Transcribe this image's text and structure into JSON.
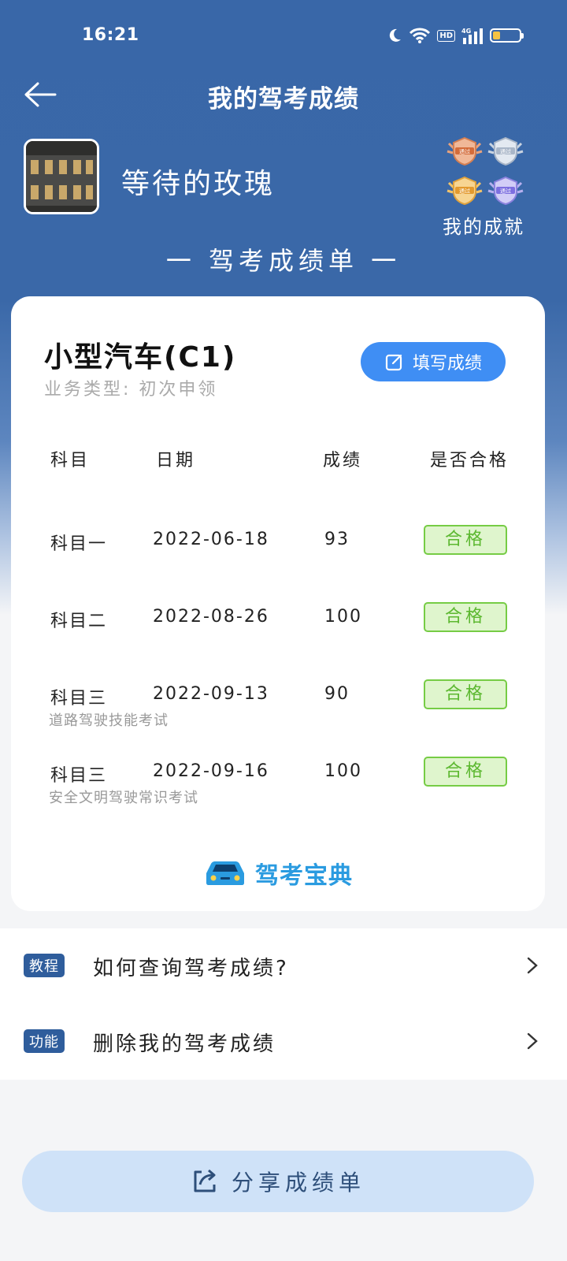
{
  "status_bar": {
    "time": "16:21",
    "hd": "HD",
    "network": "4G"
  },
  "header": {
    "title": "我的驾考成绩"
  },
  "profile": {
    "username": "等待的玫瑰",
    "achievements_label": "我的成就",
    "medal_text": "通过"
  },
  "section_title": "一 驾考成绩单 一",
  "card": {
    "car_type": "小型汽车(C1)",
    "business_type": "业务类型: 初次申领",
    "fill_button": "填写成绩",
    "headers": {
      "subject": "科目",
      "date": "日期",
      "score": "成绩",
      "pass": "是否合格"
    },
    "rows": [
      {
        "subject": "科目一",
        "date": "2022-06-18",
        "score": "93",
        "status": "合格",
        "note": ""
      },
      {
        "subject": "科目二",
        "date": "2022-08-26",
        "score": "100",
        "status": "合格",
        "note": ""
      },
      {
        "subject": "科目三",
        "date": "2022-09-13",
        "score": "90",
        "status": "合格",
        "note": "道路驾驶技能考试"
      },
      {
        "subject": "科目三",
        "date": "2022-09-16",
        "score": "100",
        "status": "合格",
        "note": "安全文明驾驶常识考试"
      }
    ],
    "brand": "驾考宝典"
  },
  "links": [
    {
      "tag": "教程",
      "text": "如何查询驾考成绩?"
    },
    {
      "tag": "功能",
      "text": "删除我的驾考成绩"
    }
  ],
  "share_button": "分享成绩单",
  "colors": {
    "header_blue": "#3967a8",
    "primary_button": "#3f8ef4",
    "pass_green": "#5cb830",
    "tag_blue": "#2f5d9c",
    "share_bg": "#cfe2f8"
  }
}
